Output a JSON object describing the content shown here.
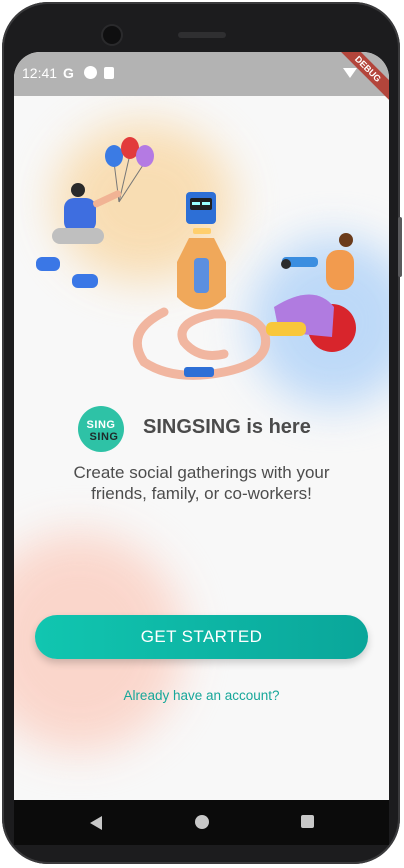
{
  "status_bar": {
    "time": "12:41",
    "icon_g": "G",
    "debug_label": "DEBUG"
  },
  "brand": {
    "logo_line1": "SING",
    "logo_line2": "SING",
    "title": "SINGSING is here"
  },
  "onboarding": {
    "subtitle": "Create social gatherings with your friends, family, or co-workers!"
  },
  "actions": {
    "primary_label": "GET STARTED",
    "secondary_link": "Already have an account?"
  },
  "colors": {
    "primary": "#11c6b0",
    "link": "#17a79a",
    "status_bar": "#b3b3b3"
  },
  "icons": {
    "wifi": "wifi-icon",
    "back": "back-icon",
    "home": "home-icon",
    "recents": "recents-icon"
  }
}
